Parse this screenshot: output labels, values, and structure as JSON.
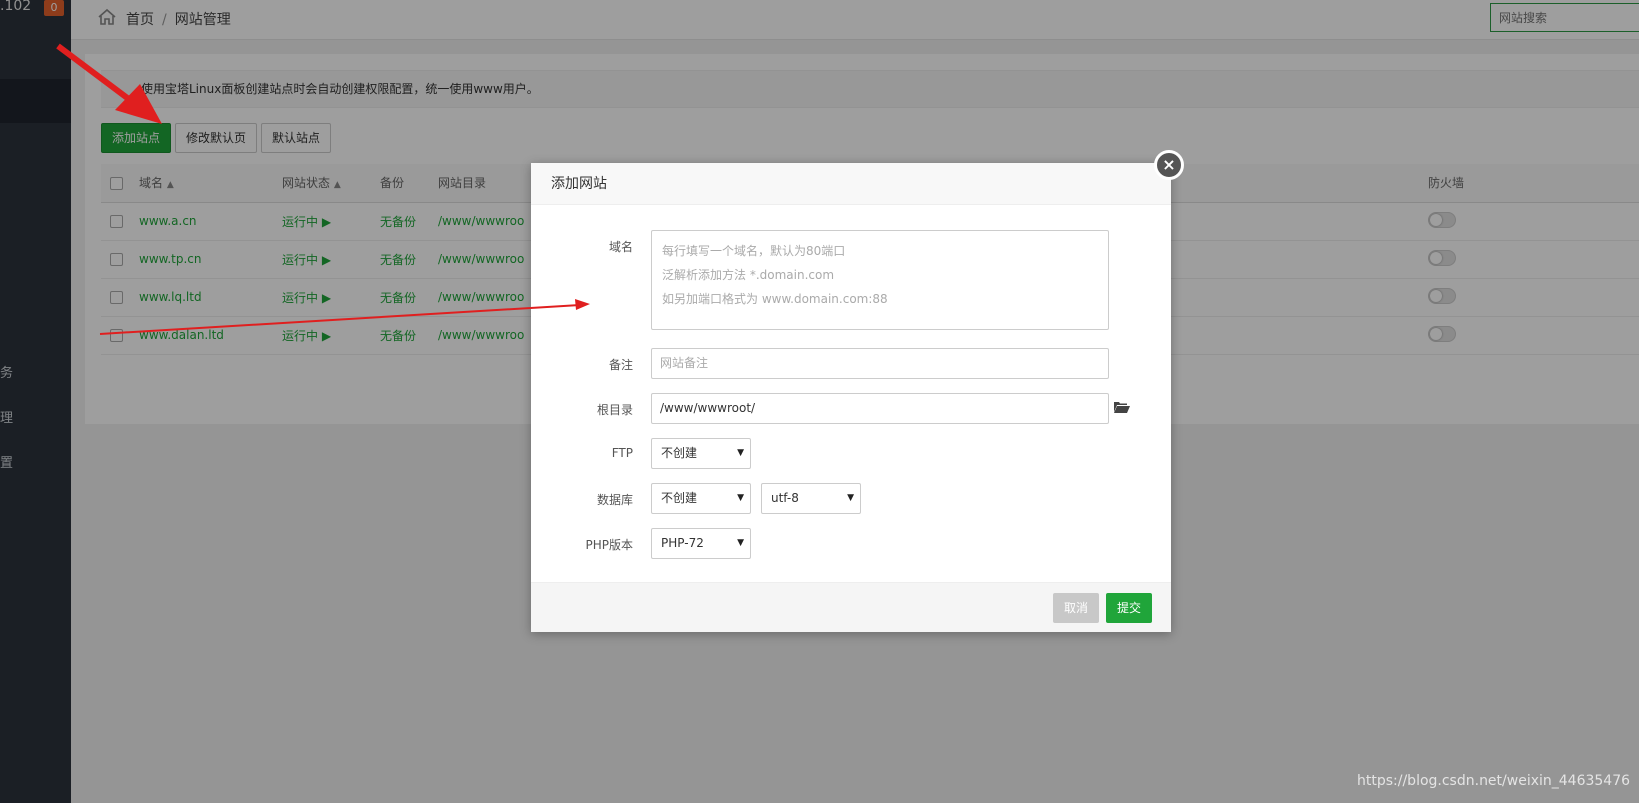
{
  "sidebar": {
    "ip_fragment": ".102",
    "badge": "0",
    "tail_items": [
      "务",
      "理",
      "置"
    ]
  },
  "header": {
    "breadcrumb_home": "首页",
    "breadcrumb_sep": "/",
    "breadcrumb_current": "网站管理",
    "search_placeholder": "网站搜索"
  },
  "notice": {
    "text": "使用宝塔Linux面板创建站点时会自动创建权限配置，统一使用www用户。"
  },
  "toolbar": {
    "add_site": "添加站点",
    "edit_default_page": "修改默认页",
    "default_site": "默认站点"
  },
  "table": {
    "headers": {
      "domain": "域名",
      "status": "网站状态",
      "backup": "备份",
      "root": "网站目录",
      "firewall": "防火墙"
    },
    "rows": [
      {
        "domain": "www.a.cn",
        "status": "运行中 ▶",
        "backup": "无备份",
        "root": "/www/wwwroo"
      },
      {
        "domain": "www.tp.cn",
        "status": "运行中 ▶",
        "backup": "无备份",
        "root": "/www/wwwroo"
      },
      {
        "domain": "www.lq.ltd",
        "status": "运行中 ▶",
        "backup": "无备份",
        "root": "/www/wwwroo"
      },
      {
        "domain": "www.dalan.ltd",
        "status": "运行中 ▶",
        "backup": "无备份",
        "root": "/www/wwwroo"
      }
    ]
  },
  "modal": {
    "title": "添加网站",
    "close": "×",
    "domain_label": "域名",
    "domain_placeholder_lines": [
      "每行填写一个域名，默认为80端口",
      "泛解析添加方法 *.domain.com",
      "如另加端口格式为 www.domain.com:88"
    ],
    "remark_label": "备注",
    "remark_placeholder": "网站备注",
    "root_label": "根目录",
    "root_value": "/www/wwwroot/",
    "ftp_label": "FTP",
    "ftp_value": "不创建",
    "db_label": "数据库",
    "db_value": "不创建",
    "charset_value": "utf-8",
    "php_label": "PHP版本",
    "php_value": "PHP-72",
    "cancel": "取消",
    "submit": "提交"
  },
  "watermark": "https://blog.csdn.net/weixin_44635476",
  "colors": {
    "accent": "#20a53a",
    "sidebar": "#2c323d",
    "badge": "#e6622d",
    "arrow": "#e01f1f"
  }
}
